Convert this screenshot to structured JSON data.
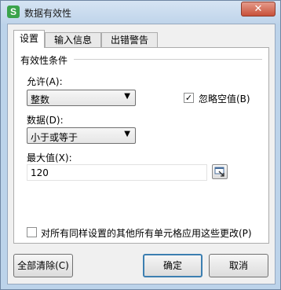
{
  "window": {
    "title": "数据有效性",
    "app_icon_letter": "S",
    "close_glyph": "✕"
  },
  "tabs": [
    {
      "label": "设置",
      "active": true
    },
    {
      "label": "输入信息",
      "active": false
    },
    {
      "label": "出错警告",
      "active": false
    }
  ],
  "settings": {
    "group_label": "有效性条件",
    "allow_label": "允许(A):",
    "allow_value": "整数",
    "ignore_blank_label": "忽略空值(B)",
    "ignore_blank_checked": true,
    "data_label": "数据(D):",
    "data_value": "小于或等于",
    "max_label": "最大值(X):",
    "max_value": "120",
    "apply_all_label": "对所有同样设置的其他所有单元格应用这些更改(P)",
    "apply_all_checked": false
  },
  "buttons": {
    "clear_all": "全部清除(C)",
    "ok": "确定",
    "cancel": "取消"
  },
  "icons": {
    "dropdown": "chevron-down-icon",
    "range_picker": "range-picker-icon",
    "check": "check-icon"
  }
}
